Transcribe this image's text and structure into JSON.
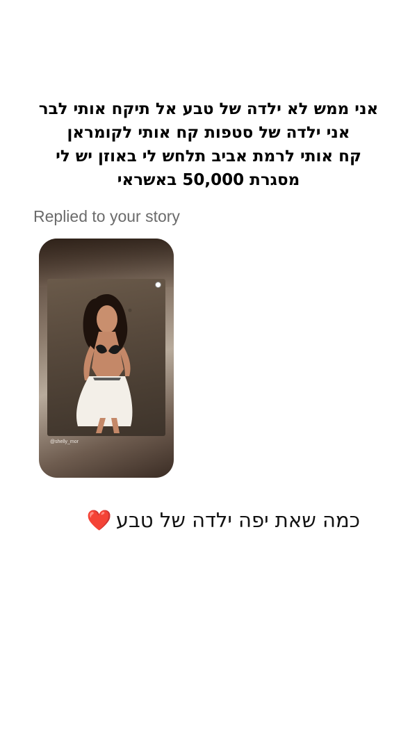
{
  "caption": {
    "lines": [
      "אני ממש לא ילדה של טבע אל תיקח אותי לבר",
      "אני ילדה של סטפות קח אותי לקומראן",
      "קח אותי לרמת אביב תלחש לי באוזן יש לי",
      "מסגרת 50,000 באשראי"
    ]
  },
  "reply": {
    "meta_label": "Replied to your story",
    "story": {
      "username": "@shelly_mor"
    }
  },
  "message": {
    "text": "כמה שאת יפה ילדה של טבע",
    "emoji": "❤️"
  }
}
